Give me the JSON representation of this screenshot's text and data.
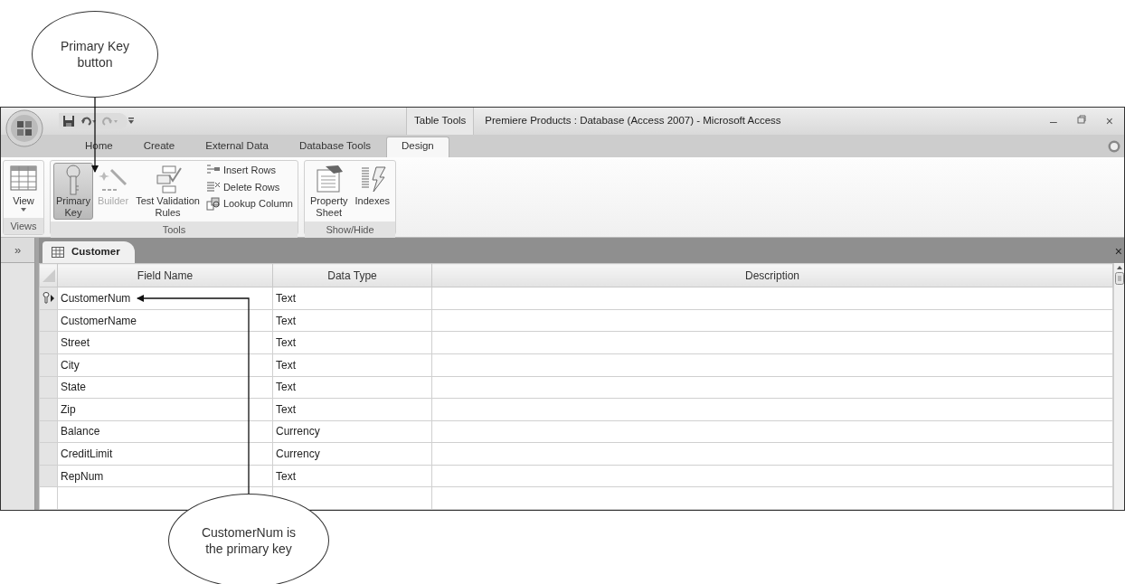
{
  "callouts": [
    {
      "text": "Primary Key button"
    },
    {
      "text": "CustomerNum is the primary key"
    }
  ],
  "window": {
    "context_label": "Table Tools",
    "title": "Premiere Products : Database (Access 2007) - Microsoft Access",
    "minimize": "–",
    "close": "×"
  },
  "ribbon_tabs": [
    {
      "label": "Home",
      "selected": false
    },
    {
      "label": "Create",
      "selected": false
    },
    {
      "label": "External Data",
      "selected": false
    },
    {
      "label": "Database Tools",
      "selected": false
    },
    {
      "label": "Design",
      "selected": true
    }
  ],
  "ribbon_groups": [
    {
      "label": "Views",
      "items": [
        {
          "kind": "view",
          "label": "View",
          "selected": false,
          "disabled": false
        }
      ]
    },
    {
      "label": "Tools",
      "items": [
        {
          "kind": "key",
          "label": "Primary\nKey",
          "selected": true,
          "disabled": false
        },
        {
          "kind": "builder",
          "label": "Builder",
          "selected": false,
          "disabled": true
        },
        {
          "kind": "validate",
          "label": "Test Validation\nRules",
          "selected": false,
          "disabled": false
        },
        {
          "kind": "insert",
          "label": "Insert Rows",
          "selected": false,
          "disabled": false
        },
        {
          "kind": "delete",
          "label": "Delete Rows",
          "selected": false,
          "disabled": false
        },
        {
          "kind": "lookup",
          "label": "Lookup Column",
          "selected": false,
          "disabled": false
        }
      ]
    },
    {
      "label": "Show/Hide",
      "items": [
        {
          "kind": "sheet",
          "label": "Property\nSheet",
          "selected": false,
          "disabled": false
        },
        {
          "kind": "indexes",
          "label": "Indexes",
          "selected": false,
          "disabled": false
        }
      ]
    }
  ],
  "nav_pane": {
    "toggle": "»"
  },
  "document": {
    "tab": "Customer",
    "close": "×",
    "columns": [
      "Field Name",
      "Data Type",
      "Description"
    ],
    "rows": [
      {
        "field_name": "CustomerNum",
        "data_type": "Text",
        "primary_key": true,
        "current": true
      },
      {
        "field_name": "CustomerName",
        "data_type": "Text",
        "primary_key": false,
        "current": false
      },
      {
        "field_name": "Street",
        "data_type": "Text",
        "primary_key": false,
        "current": false
      },
      {
        "field_name": "City",
        "data_type": "Text",
        "primary_key": false,
        "current": false
      },
      {
        "field_name": "State",
        "data_type": "Text",
        "primary_key": false,
        "current": false
      },
      {
        "field_name": "Zip",
        "data_type": "Text",
        "primary_key": false,
        "current": false
      },
      {
        "field_name": "Balance",
        "data_type": "Currency",
        "primary_key": false,
        "current": false
      },
      {
        "field_name": "CreditLimit",
        "data_type": "Currency",
        "primary_key": false,
        "current": false
      },
      {
        "field_name": "RepNum",
        "data_type": "Text",
        "primary_key": false,
        "current": false
      }
    ]
  }
}
